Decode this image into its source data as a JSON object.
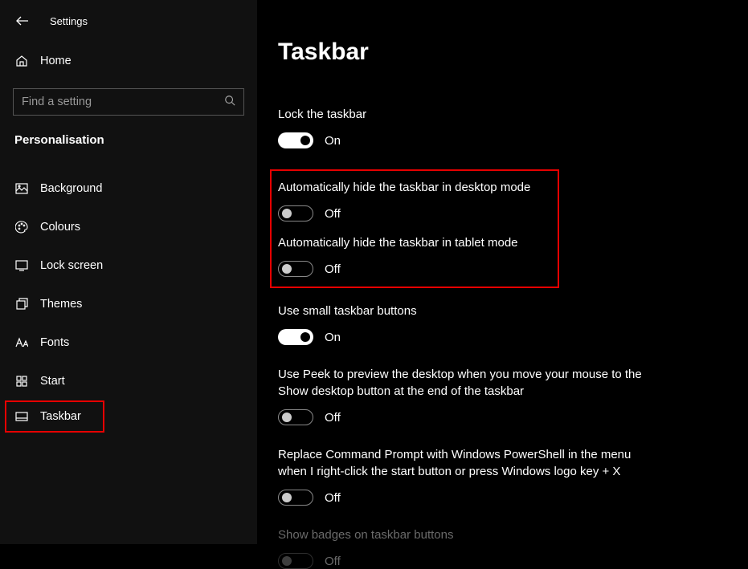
{
  "header": {
    "title": "Settings"
  },
  "home": {
    "label": "Home"
  },
  "search": {
    "placeholder": "Find a setting"
  },
  "category": "Personalisation",
  "nav": [
    {
      "label": "Background"
    },
    {
      "label": "Colours"
    },
    {
      "label": "Lock screen"
    },
    {
      "label": "Themes"
    },
    {
      "label": "Fonts"
    },
    {
      "label": "Start"
    },
    {
      "label": "Taskbar"
    }
  ],
  "page_title": "Taskbar",
  "settings": {
    "lock": {
      "label": "Lock the taskbar",
      "state": "On"
    },
    "autohide_d": {
      "label": "Automatically hide the taskbar in desktop mode",
      "state": "Off"
    },
    "autohide_t": {
      "label": "Automatically hide the taskbar in tablet mode",
      "state": "Off"
    },
    "small": {
      "label": "Use small taskbar buttons",
      "state": "On"
    },
    "peek": {
      "label": "Use Peek to preview the desktop when you move your mouse to the Show desktop button at the end of the taskbar",
      "state": "Off"
    },
    "powershell": {
      "label": "Replace Command Prompt with Windows PowerShell in the menu when I right-click the start button or press Windows logo key + X",
      "state": "Off"
    },
    "badges": {
      "label": "Show badges on taskbar buttons",
      "state": "Off"
    }
  }
}
